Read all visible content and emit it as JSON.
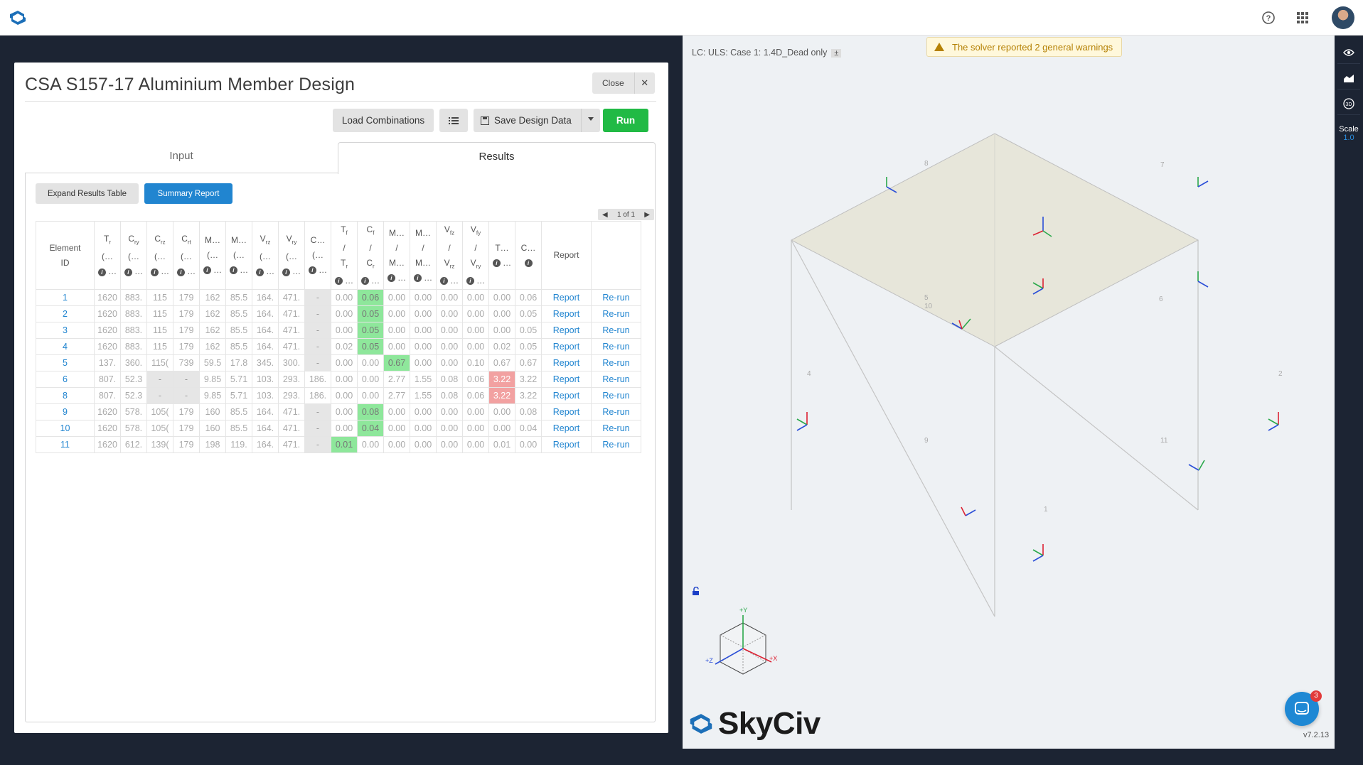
{
  "topbar": {
    "help_icon": "help-circle-icon",
    "apps_icon": "grid-apps-icon"
  },
  "dialog": {
    "title": "CSA S157-17 Aluminium Member Design",
    "close_label": "Close",
    "toolbar": {
      "load_combinations": "Load Combinations",
      "save_design_data": "Save Design Data",
      "run": "Run"
    },
    "tabs": {
      "input": "Input",
      "results": "Results"
    },
    "results": {
      "expand_results_table": "Expand Results Table",
      "summary_report": "Summary Report",
      "pager": "1 of 1"
    }
  },
  "table": {
    "header_report": "Report",
    "rows": [
      {
        "id": "1",
        "c": [
          "1620",
          "883.",
          "115",
          "179",
          "162",
          "85.5",
          "164.",
          "471.",
          "-",
          "0.00",
          "0.06",
          "0.00",
          "0.00",
          "0.00",
          "0.00",
          "0.00",
          "0.06"
        ],
        "report": "Report",
        "rerun": "Re-run"
      },
      {
        "id": "2",
        "c": [
          "1620",
          "883.",
          "115",
          "179",
          "162",
          "85.5",
          "164.",
          "471.",
          "-",
          "0.00",
          "0.05",
          "0.00",
          "0.00",
          "0.00",
          "0.00",
          "0.00",
          "0.05"
        ],
        "report": "Report",
        "rerun": "Re-run"
      },
      {
        "id": "3",
        "c": [
          "1620",
          "883.",
          "115",
          "179",
          "162",
          "85.5",
          "164.",
          "471.",
          "-",
          "0.00",
          "0.05",
          "0.00",
          "0.00",
          "0.00",
          "0.00",
          "0.00",
          "0.05"
        ],
        "report": "Report",
        "rerun": "Re-run"
      },
      {
        "id": "4",
        "c": [
          "1620",
          "883.",
          "115",
          "179",
          "162",
          "85.5",
          "164.",
          "471.",
          "-",
          "0.02",
          "0.05",
          "0.00",
          "0.00",
          "0.00",
          "0.00",
          "0.02",
          "0.05"
        ],
        "report": "Report",
        "rerun": "Re-run"
      },
      {
        "id": "5",
        "c": [
          "137.",
          "360.",
          "115(",
          "739",
          "59.5",
          "17.8",
          "345.",
          "300.",
          "-",
          "0.00",
          "0.00",
          "0.67",
          "0.00",
          "0.00",
          "0.10",
          "0.67",
          "0.67"
        ],
        "report": "Report",
        "rerun": "Re-run"
      },
      {
        "id": "6",
        "c": [
          "807.",
          "52.3",
          "-",
          "-",
          "9.85",
          "5.71",
          "103.",
          "293.",
          "186.",
          "0.00",
          "0.00",
          "2.77",
          "1.55",
          "0.08",
          "0.06",
          "3.22",
          "3.22"
        ],
        "report": "Report",
        "rerun": "Re-run"
      },
      {
        "id": "8",
        "c": [
          "807.",
          "52.3",
          "-",
          "-",
          "9.85",
          "5.71",
          "103.",
          "293.",
          "186.",
          "0.00",
          "0.00",
          "2.77",
          "1.55",
          "0.08",
          "0.06",
          "3.22",
          "3.22"
        ],
        "report": "Report",
        "rerun": "Re-run"
      },
      {
        "id": "9",
        "c": [
          "1620",
          "578.",
          "105(",
          "179",
          "160",
          "85.5",
          "164.",
          "471.",
          "-",
          "0.00",
          "0.08",
          "0.00",
          "0.00",
          "0.00",
          "0.00",
          "0.00",
          "0.08"
        ],
        "report": "Report",
        "rerun": "Re-run"
      },
      {
        "id": "10",
        "c": [
          "1620",
          "578.",
          "105(",
          "179",
          "160",
          "85.5",
          "164.",
          "471.",
          "-",
          "0.00",
          "0.04",
          "0.00",
          "0.00",
          "0.00",
          "0.00",
          "0.00",
          "0.04"
        ],
        "report": "Report",
        "rerun": "Re-run"
      },
      {
        "id": "11",
        "c": [
          "1620",
          "612.",
          "139(",
          "179",
          "198",
          "119.",
          "164.",
          "471.",
          "-",
          "0.01",
          "0.00",
          "0.00",
          "0.00",
          "0.00",
          "0.00",
          "0.01",
          "0.00"
        ],
        "report": "Report",
        "rerun": "Re-run"
      }
    ],
    "highlight_colors": {
      "green": "#8ee79b",
      "red": "#f2a1a1",
      "grey": "#e6e6e6"
    }
  },
  "viewer": {
    "load_case": "LC: ULS: Case 1: 1.4D_Dead only",
    "load_case_toggle": "±",
    "warning": "The solver reported 2 general warnings",
    "member_labels": [
      "8",
      "7",
      "5",
      "10",
      "6",
      "4",
      "2",
      "9",
      "11",
      "1"
    ],
    "axis_labels": {
      "y": "+Y",
      "z": "+Z",
      "x": "+X"
    },
    "brand": "SkyCiv",
    "version": "v7.2.13",
    "chat_badge": "3",
    "sidebar": {
      "scale_label": "Scale",
      "scale_value": "1.0",
      "view_3d": "3D"
    }
  },
  "colors": {
    "accent": "#2185d0",
    "run": "#21ba45",
    "warning": "#b58105",
    "dark": "#1c2433"
  }
}
